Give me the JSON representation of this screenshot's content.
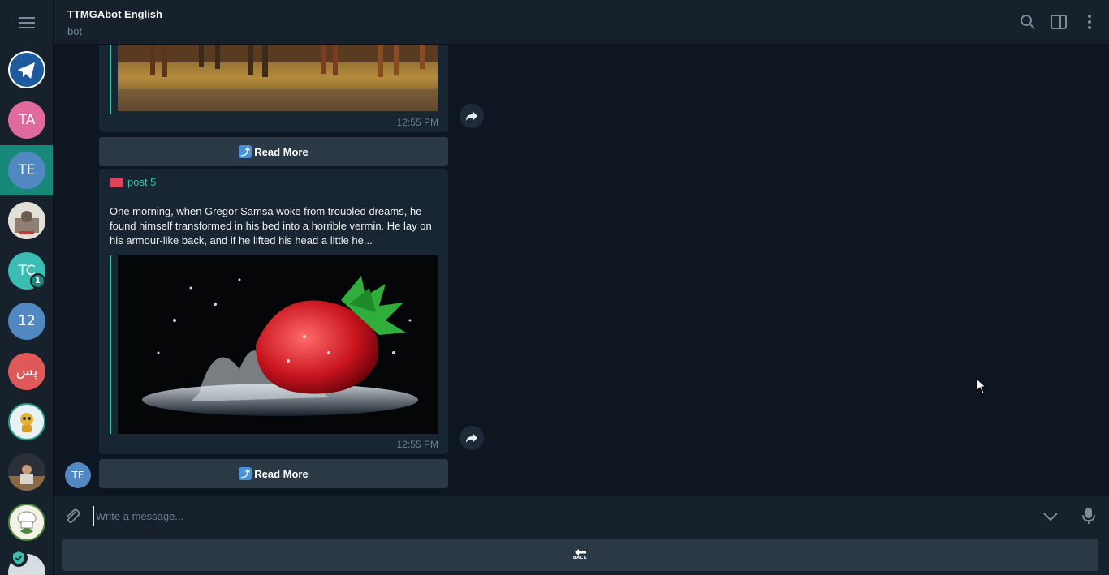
{
  "header": {
    "title": "TTMGAbot English",
    "status": "bot"
  },
  "sidebar": {
    "items": [
      {
        "name": "telegram-channel",
        "initials": "",
        "color": "#ffffff"
      },
      {
        "name": "chat-ta",
        "initials": "TA",
        "color": "#e06a9c"
      },
      {
        "name": "chat-te",
        "initials": "TE",
        "color": "#5288c1",
        "active": true
      },
      {
        "name": "chat-photo-1",
        "initials": "",
        "color": "#c9c3bd"
      },
      {
        "name": "chat-tc",
        "initials": "TC",
        "color": "#3bbdb3",
        "unread": "1"
      },
      {
        "name": "chat-12",
        "initials": "12",
        "color": "#5288c1"
      },
      {
        "name": "chat-arabic",
        "initials": "پس",
        "color": "#e0595a"
      },
      {
        "name": "chat-robot",
        "initials": "",
        "color": "#e8f1f3"
      },
      {
        "name": "chat-photo-2",
        "initials": "",
        "color": "#5b4b3a"
      },
      {
        "name": "chat-chef",
        "initials": "",
        "color": "#2f6f3e"
      }
    ]
  },
  "messages": {
    "post4": {
      "time": "12:55 PM",
      "read_more": "Read More"
    },
    "post5": {
      "title": "post 5",
      "text": " One morning, when Gregor Samsa woke from troubled dreams, he found himself transformed in his bed into a horrible vermin. He lay on his armour-like back, and if he lifted his head a little he...",
      "time": "12:55 PM",
      "read_more": "Read More",
      "sender_initials": "TE"
    }
  },
  "composer": {
    "placeholder": "Write a message..."
  },
  "keyboard": {
    "back_label": "BACK"
  },
  "colors": {
    "accent": "#3bc0b0",
    "background": "#0e1621",
    "panel": "#17212b",
    "bubble": "#182533"
  }
}
